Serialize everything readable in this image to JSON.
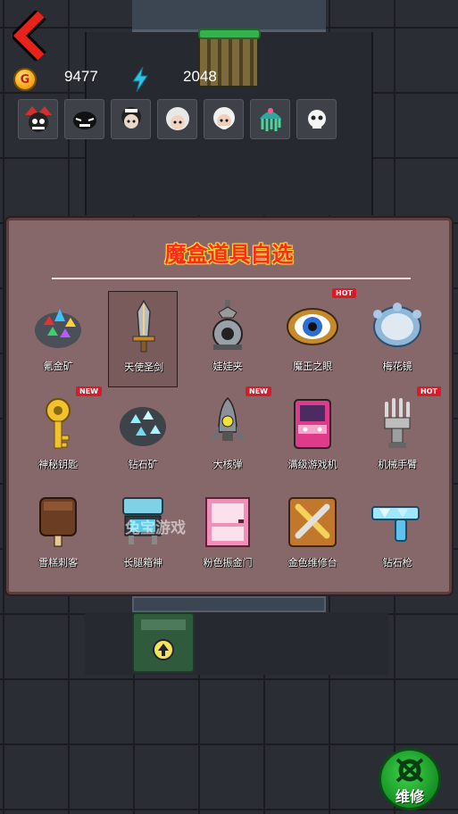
{
  "hud": {
    "coin_icon_letter": "G",
    "coins": "9477",
    "energy": "2048"
  },
  "heroes": [
    {
      "icon": "hero-jester-icon"
    },
    {
      "icon": "hero-dark-knight-icon"
    },
    {
      "icon": "hero-maid-icon"
    },
    {
      "icon": "hero-white-hair-icon"
    },
    {
      "icon": "hero-old-man-icon"
    },
    {
      "icon": "hero-jellyfish-icon"
    },
    {
      "icon": "hero-skull-icon"
    }
  ],
  "dialog": {
    "title": "魔盒道具自选",
    "items": [
      {
        "label": "氪金矿",
        "icon": "gem-ore-icon",
        "badge": ""
      },
      {
        "label": "天使圣剑",
        "icon": "angel-sword-icon",
        "badge": ""
      },
      {
        "label": "娃娃夹",
        "icon": "claw-machine-icon",
        "badge": ""
      },
      {
        "label": "魔王之眼",
        "icon": "demon-eye-icon",
        "badge": "HOT"
      },
      {
        "label": "梅花镜",
        "icon": "plum-mirror-icon",
        "badge": ""
      },
      {
        "label": "神秘钥匙",
        "icon": "mystery-key-icon",
        "badge": "NEW"
      },
      {
        "label": "钻石矿",
        "icon": "diamond-ore-icon",
        "badge": ""
      },
      {
        "label": "大核弹",
        "icon": "nuke-icon",
        "badge": "NEW"
      },
      {
        "label": "满级游戏机",
        "icon": "arcade-icon",
        "badge": ""
      },
      {
        "label": "机械手臂",
        "icon": "robot-arm-icon",
        "badge": "HOT"
      },
      {
        "label": "雪糕刺客",
        "icon": "ice-cream-icon",
        "badge": ""
      },
      {
        "label": "长腿箱神",
        "icon": "leg-box-icon",
        "badge": ""
      },
      {
        "label": "粉色振金门",
        "icon": "pink-door-icon",
        "badge": ""
      },
      {
        "label": "金色维修台",
        "icon": "repair-table-icon",
        "badge": ""
      },
      {
        "label": "钻石枪",
        "icon": "diamond-gun-icon",
        "badge": ""
      }
    ],
    "selected_index": 1
  },
  "watermark": "兔宝游戏",
  "repair_button": {
    "label": "维修"
  }
}
